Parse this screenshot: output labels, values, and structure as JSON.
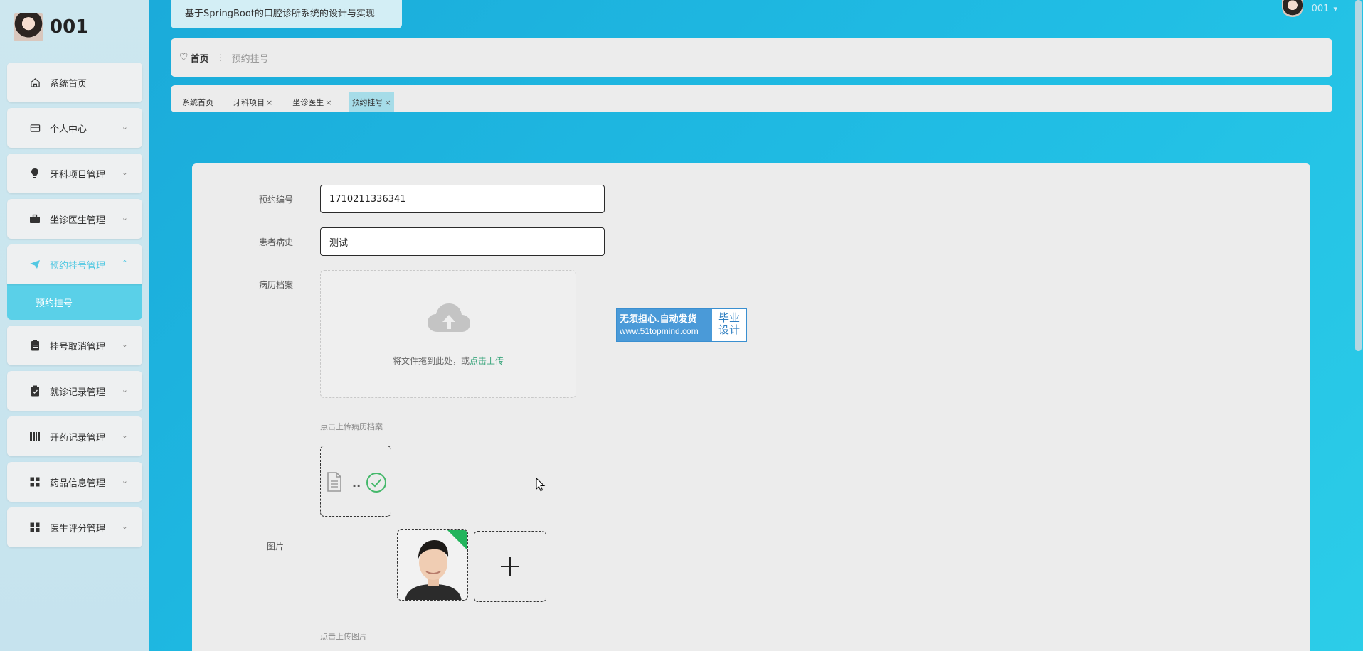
{
  "sidebar": {
    "username": "001",
    "items": [
      {
        "label": "系统首页",
        "icon": "home-icon",
        "chevron": ""
      },
      {
        "label": "个人中心",
        "icon": "card-icon",
        "chevron": "⌄"
      },
      {
        "label": "牙科项目管理",
        "icon": "bulb-icon",
        "chevron": "⌄"
      },
      {
        "label": "坐诊医生管理",
        "icon": "briefcase-icon",
        "chevron": "⌄"
      },
      {
        "label": "预约挂号管理",
        "icon": "send-icon",
        "chevron": "⌃"
      },
      {
        "label": "挂号取消管理",
        "icon": "clipboard-icon",
        "chevron": "⌄"
      },
      {
        "label": "就诊记录管理",
        "icon": "clipboard-check-icon",
        "chevron": "⌄"
      },
      {
        "label": "开药记录管理",
        "icon": "books-icon",
        "chevron": "⌄"
      },
      {
        "label": "药品信息管理",
        "icon": "grid-icon",
        "chevron": "⌄"
      },
      {
        "label": "医生评分管理",
        "icon": "grid-icon",
        "chevron": "⌄"
      }
    ],
    "submenu_label": "预约挂号"
  },
  "header": {
    "system_title": "基于SpringBoot的口腔诊所系统的设计与实现",
    "user_name": "001",
    "caret": "▾"
  },
  "breadcrumb": {
    "heart": "♡",
    "home": "首页",
    "separator": "⋮",
    "current": "预约挂号"
  },
  "tags": [
    {
      "label": "系统首页",
      "closable": false
    },
    {
      "label": "牙科项目",
      "closable": true
    },
    {
      "label": "坐诊医生",
      "closable": true
    },
    {
      "label": "预约挂号",
      "closable": true,
      "active": true
    }
  ],
  "tag_close": "×",
  "form": {
    "booking_no_label": "预约编号",
    "booking_no_value": "1710211336341",
    "history_label": "患者病史",
    "history_value": "测试",
    "record_label": "病历档案",
    "upload_drag_text": "将文件拖到此处，或",
    "upload_link_text": "点击上传",
    "record_hint": "点击上传病历档案",
    "file_name_dots": "..",
    "image_label": "图片",
    "image_hint": "点击上传图片"
  },
  "watermark": {
    "line1": "无须担心.自动发货",
    "line2": "www.51topmind.com",
    "right1": "毕业",
    "right2": "设计"
  },
  "colors": {
    "accent": "#52c8e2",
    "link_green": "#3aa57c",
    "success": "#44b86a"
  }
}
